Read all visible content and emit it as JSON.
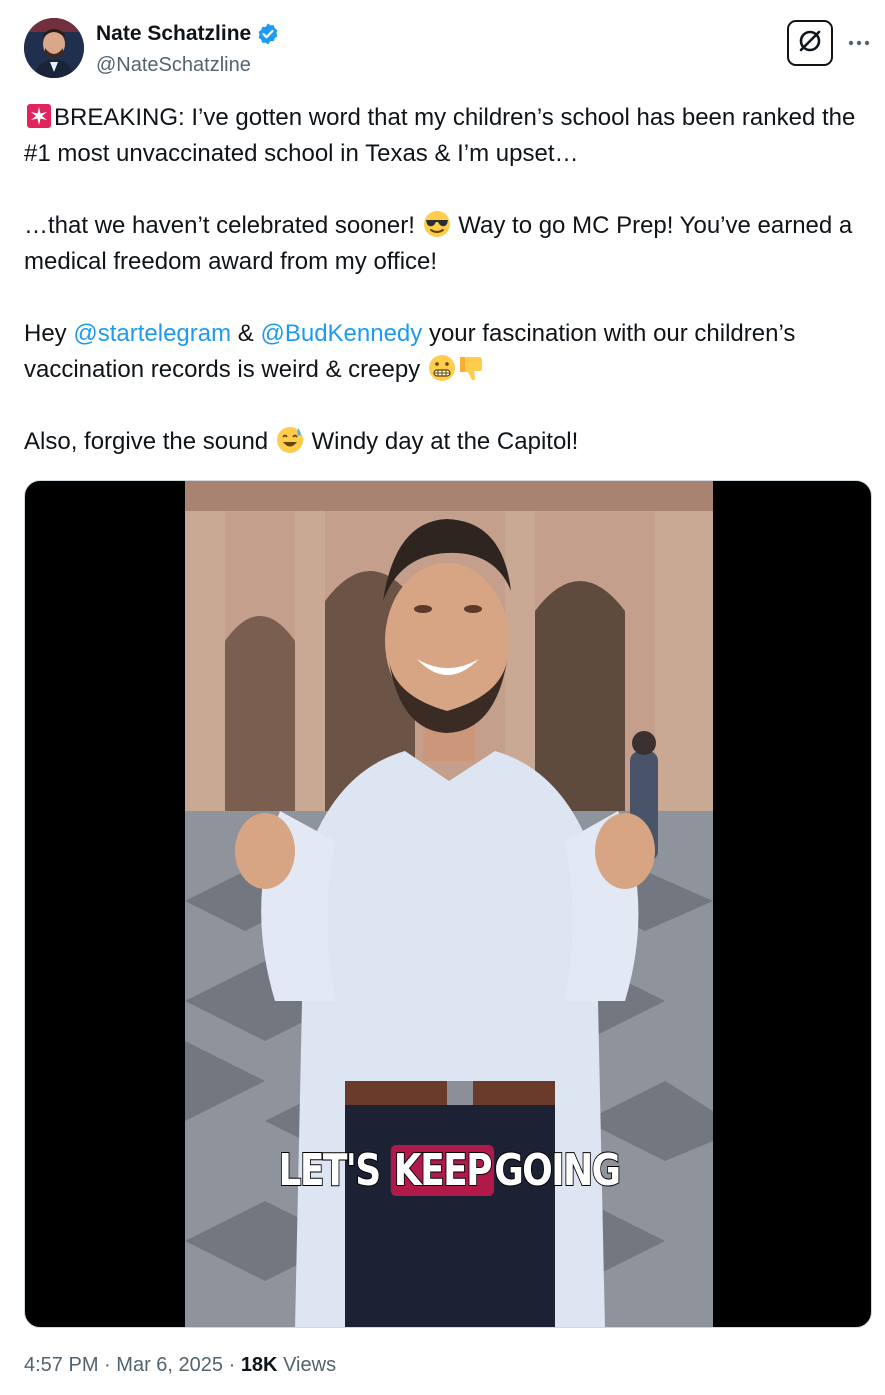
{
  "author": {
    "display_name": "Nate Schatzline",
    "handle": "@NateSchatzline",
    "verified": true,
    "verified_color": "#1d9bf0"
  },
  "icons": {
    "grok": "grok-icon",
    "more": "more-options-icon"
  },
  "tweet": {
    "p1_emoji": "rotating-light-emoji",
    "p1_text": "BREAKING: I’ve gotten word that my children’s school has been ranked the #1 most unvaccinated school in Texas & I’m upset…",
    "p2_a": "…that we haven’t celebrated sooner!",
    "p2_emoji": "sunglasses-emoji",
    "p2_b": "Way to go MC Prep! You’ve earned a medical freedom award from my office!",
    "p3_a": "Hey",
    "mention_1": "@startelegram",
    "p3_b": "&",
    "mention_2": "@BudKennedy",
    "p3_c": "your fascination with our children’s vaccination records is weird & creepy",
    "p3_emojis": [
      "grimacing-emoji",
      "thumbs-down-emoji"
    ],
    "p4_a": "Also, forgive the sound",
    "p4_emoji": "sweat-smile-emoji",
    "p4_b": "Windy day at the Capitol!",
    "mention_color": "#1d9bf0"
  },
  "media": {
    "type": "video",
    "caption_word_1": "LET'S",
    "caption_word_2": "KEEP",
    "caption_word_3": "GOING",
    "caption_highlight_color": "#b0194a"
  },
  "meta": {
    "time": "4:57 PM",
    "sep1": "·",
    "date": "Mar 6, 2025",
    "sep2": "·",
    "views_count": "18K",
    "views_label": "Views"
  }
}
